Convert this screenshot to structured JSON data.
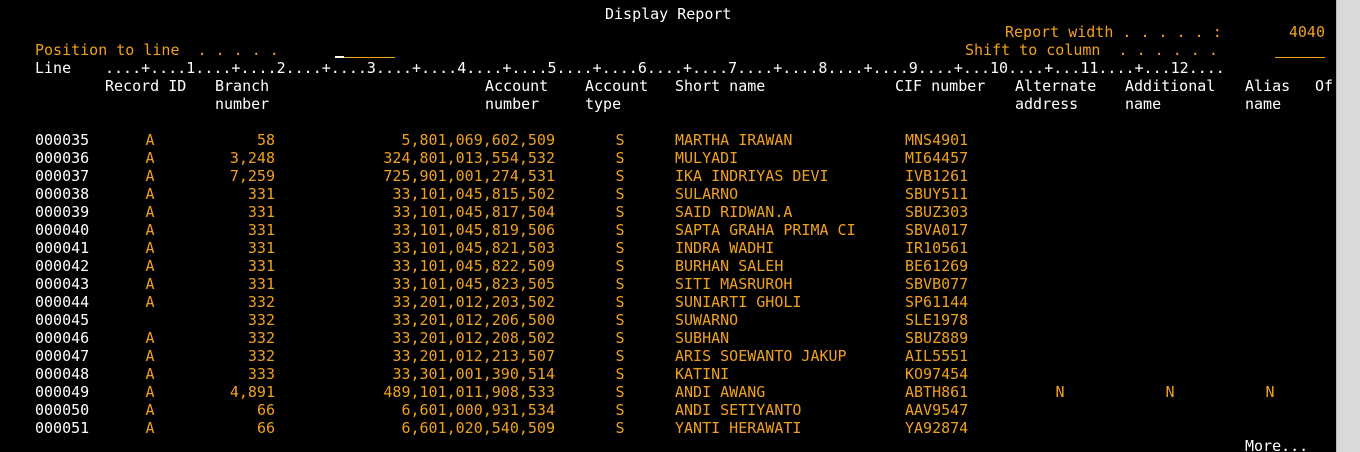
{
  "screen": {
    "title": "Display Report",
    "report_width_label": "Report width . . . . . :",
    "report_width_value": "4040",
    "position_label": "Position to line  . . . . .",
    "position_value": "",
    "shift_label": "Shift to column  . . . . . .",
    "shift_value": "",
    "line_label": "Line",
    "ruler": "....+....1....+....2....+....3....+....4....+....5....+....6....+....7....+....8....+....9....+...10....+...11....+...12....",
    "more": "More..."
  },
  "columns": {
    "record_id": "Record ID",
    "branch_1": "Branch",
    "branch_2": "number",
    "account_1": "Account",
    "account_2": "number",
    "acctype_1": "Account",
    "acctype_2": "type",
    "short_name": "Short name",
    "cif": "CIF number",
    "alt_1": "Alternate",
    "alt_2": "address",
    "addl_1": "Additional",
    "addl_2": "name",
    "alias_1": "Alias",
    "alias_2": "name",
    "of": "Of"
  },
  "rows": [
    {
      "line": "000035",
      "rid": "A",
      "branch": "58",
      "account": "5,801,069,602,509",
      "type": "S",
      "name": "MARTHA IRAWAN",
      "cif": "MNS4901",
      "alt": "",
      "addl": "",
      "alias": ""
    },
    {
      "line": "000036",
      "rid": "A",
      "branch": "3,248",
      "account": "324,801,013,554,532",
      "type": "S",
      "name": "MULYADI",
      "cif": "MI64457",
      "alt": "",
      "addl": "",
      "alias": ""
    },
    {
      "line": "000037",
      "rid": "A",
      "branch": "7,259",
      "account": "725,901,001,274,531",
      "type": "S",
      "name": "IKA INDRIYAS DEVI",
      "cif": "IVB1261",
      "alt": "",
      "addl": "",
      "alias": ""
    },
    {
      "line": "000038",
      "rid": "A",
      "branch": "331",
      "account": "33,101,045,815,502",
      "type": "S",
      "name": "SULARNO",
      "cif": "SBUY511",
      "alt": "",
      "addl": "",
      "alias": ""
    },
    {
      "line": "000039",
      "rid": "A",
      "branch": "331",
      "account": "33,101,045,817,504",
      "type": "S",
      "name": "SAID RIDWAN.A",
      "cif": "SBUZ303",
      "alt": "",
      "addl": "",
      "alias": ""
    },
    {
      "line": "000040",
      "rid": "A",
      "branch": "331",
      "account": "33,101,045,819,506",
      "type": "S",
      "name": "SAPTA GRAHA PRIMA CI",
      "cif": "SBVA017",
      "alt": "",
      "addl": "",
      "alias": ""
    },
    {
      "line": "000041",
      "rid": "A",
      "branch": "331",
      "account": "33,101,045,821,503",
      "type": "S",
      "name": "INDRA WADHI",
      "cif": "IR10561",
      "alt": "",
      "addl": "",
      "alias": ""
    },
    {
      "line": "000042",
      "rid": "A",
      "branch": "331",
      "account": "33,101,045,822,509",
      "type": "S",
      "name": "BURHAN SALEH",
      "cif": "BE61269",
      "alt": "",
      "addl": "",
      "alias": ""
    },
    {
      "line": "000043",
      "rid": "A",
      "branch": "331",
      "account": "33,101,045,823,505",
      "type": "S",
      "name": "SITI MASRUROH",
      "cif": "SBVB077",
      "alt": "",
      "addl": "",
      "alias": ""
    },
    {
      "line": "000044",
      "rid": "A",
      "branch": "332",
      "account": "33,201,012,203,502",
      "type": "S",
      "name": "SUNIARTI GHOLI",
      "cif": "SP61144",
      "alt": "",
      "addl": "",
      "alias": ""
    },
    {
      "line": "000045",
      "rid": "",
      "branch": "332",
      "account": "33,201,012,206,500",
      "type": "S",
      "name": "SUWARNO",
      "cif": "SLE1978",
      "alt": "",
      "addl": "",
      "alias": ""
    },
    {
      "line": "000046",
      "rid": "A",
      "branch": "332",
      "account": "33,201,012,208,502",
      "type": "S",
      "name": "SUBHAN",
      "cif": "SBUZ889",
      "alt": "",
      "addl": "",
      "alias": ""
    },
    {
      "line": "000047",
      "rid": "A",
      "branch": "332",
      "account": "33,201,012,213,507",
      "type": "S",
      "name": "ARIS SOEWANTO JAKUP",
      "cif": "AIL5551",
      "alt": "",
      "addl": "",
      "alias": ""
    },
    {
      "line": "000048",
      "rid": "A",
      "branch": "333",
      "account": "33,301,001,390,514",
      "type": "S",
      "name": "KATINI",
      "cif": "KO97454",
      "alt": "",
      "addl": "",
      "alias": ""
    },
    {
      "line": "000049",
      "rid": "A",
      "branch": "4,891",
      "account": "489,101,011,908,533",
      "type": "S",
      "name": "ANDI AWANG",
      "cif": "ABTH861",
      "alt": "N",
      "addl": "N",
      "alias": "N"
    },
    {
      "line": "000050",
      "rid": "A",
      "branch": "66",
      "account": "6,601,000,931,534",
      "type": "S",
      "name": "ANDI SETIYANTO",
      "cif": "AAV9547",
      "alt": "",
      "addl": "",
      "alias": ""
    },
    {
      "line": "000051",
      "rid": "A",
      "branch": "66",
      "account": "6,601,020,540,509",
      "type": "S",
      "name": "YANTI HERAWATI",
      "cif": "YA92874",
      "alt": "",
      "addl": "",
      "alias": ""
    }
  ]
}
